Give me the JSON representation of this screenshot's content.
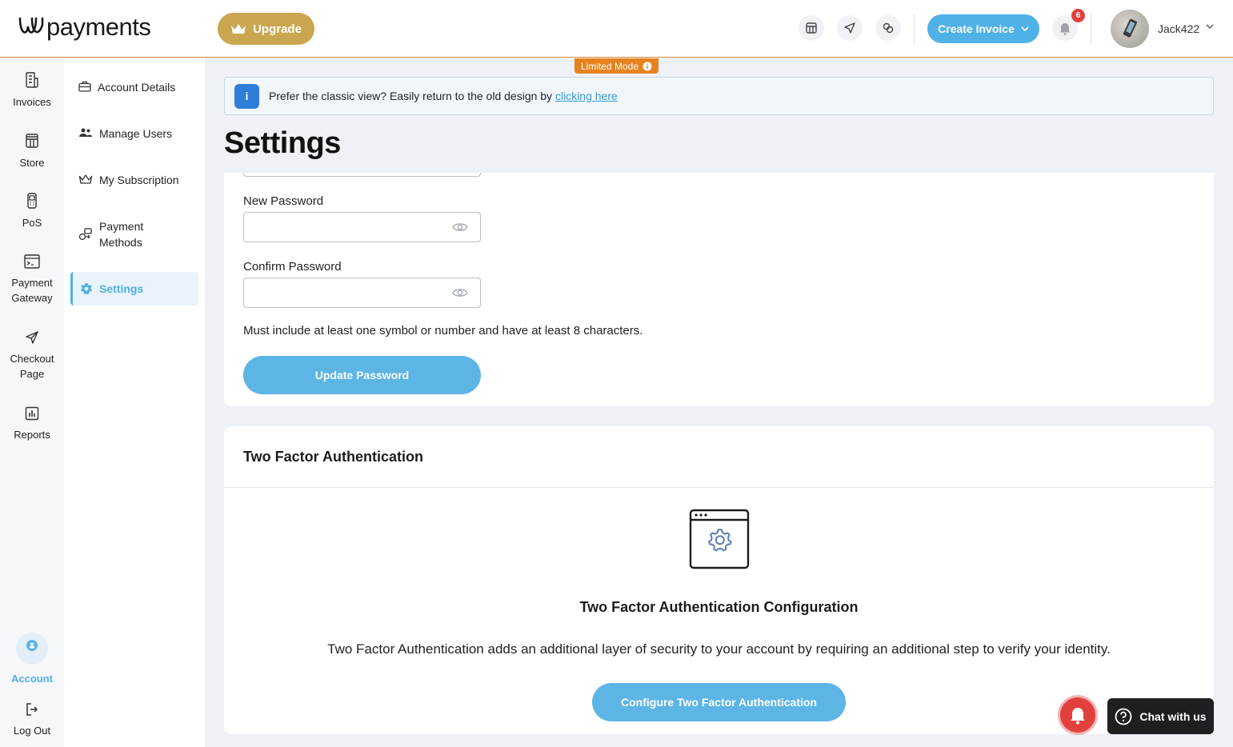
{
  "brand": {
    "logo_text": "payments"
  },
  "header": {
    "upgrade_label": "Upgrade",
    "create_invoice_label": "Create Invoice",
    "notification_count": "6",
    "username": "Jack422",
    "icons": [
      "store-icon",
      "send-icon",
      "coins-icon",
      "bell-icon"
    ]
  },
  "rail": {
    "items": [
      {
        "label": "Invoices",
        "icon": "invoice-icon"
      },
      {
        "label": "Store",
        "icon": "store-icon"
      },
      {
        "label": "PoS",
        "icon": "pos-terminal-icon"
      },
      {
        "label": "Payment Gateway",
        "icon": "terminal-window-icon"
      },
      {
        "label": "Checkout Page",
        "icon": "send-icon"
      },
      {
        "label": "Reports",
        "icon": "bar-chart-icon"
      }
    ],
    "account_label": "Account",
    "logout_label": "Log Out"
  },
  "subnav": {
    "items": [
      {
        "label": "Account Details",
        "icon": "briefcase-icon"
      },
      {
        "label": "Manage Users",
        "icon": "users-icon"
      },
      {
        "label": "My Subscription",
        "icon": "crown-icon"
      },
      {
        "label": "Payment Methods",
        "icon": "payment-methods-icon"
      },
      {
        "label": "Settings",
        "icon": "gear-icon",
        "active": true
      }
    ]
  },
  "banner": {
    "limited_mode": "Limited Mode",
    "text": "Prefer the classic view? Easily return to the old design by",
    "link_text": "clicking here"
  },
  "page": {
    "title": "Settings"
  },
  "password_card": {
    "new_password_label": "New Password",
    "new_password_value": "",
    "confirm_password_label": "Confirm Password",
    "confirm_password_value": "",
    "hint": "Must include at least one symbol or number and have at least 8 characters.",
    "update_button": "Update Password"
  },
  "tfa_card": {
    "title": "Two Factor Authentication",
    "heading": "Two Factor Authentication Configuration",
    "description": "Two Factor Authentication adds an additional layer of security to your account by requiring an additional step to verify your identity.",
    "button": "Configure Two Factor Authentication"
  },
  "chat": {
    "label": "Chat with us"
  },
  "colors": {
    "accent": "#4fb1e6",
    "upgrade": "#c9a64f",
    "limited": "#e8821f",
    "badge": "#e0413f"
  }
}
